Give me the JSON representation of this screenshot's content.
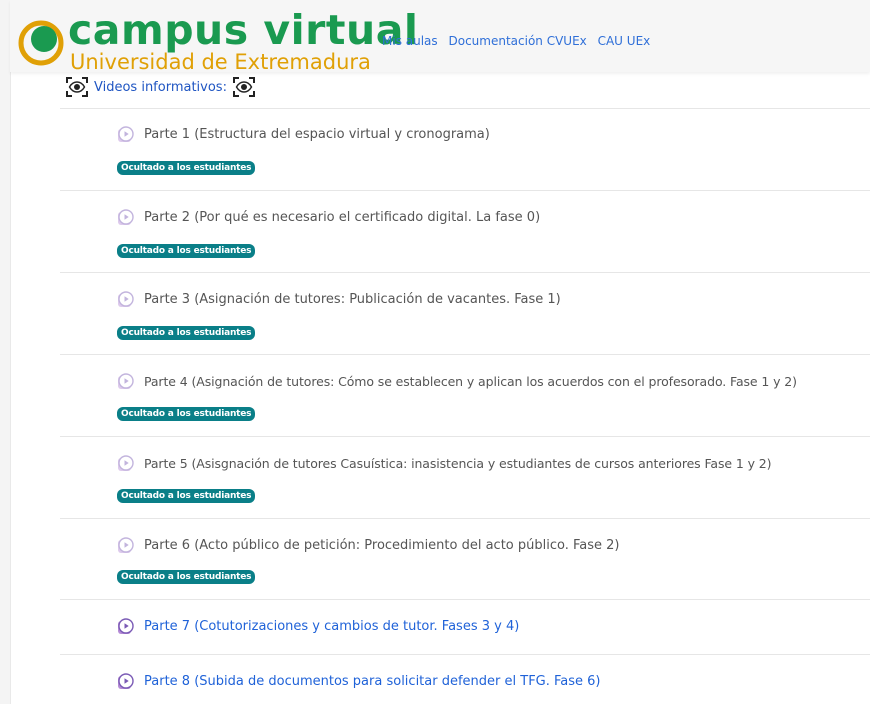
{
  "brand": {
    "title": "campus virtual",
    "subtitle": "Universidad de Extremadura",
    "colors": {
      "green": "#1a9a50",
      "gold": "#e0a006"
    }
  },
  "nav": {
    "links": [
      "Mis aulas",
      "Documentación CVUEx",
      "CAU UEx"
    ]
  },
  "section": {
    "title": "Videos informativos:",
    "icon": "eye-icon"
  },
  "items": [
    {
      "title": "Parte 1 (Estructura del espacio virtual y cronograma)",
      "badge": "Ocultado a los estudiantes"
    },
    {
      "title": "Parte 2 (Por qué es necesario el certificado digital. La fase 0)",
      "badge": "Ocultado a los estudiantes"
    },
    {
      "title": "Parte 3 (Asignación de tutores: Publicación de vacantes. Fase 1)",
      "badge": "Ocultado a los estudiantes"
    },
    {
      "title": "Parte 4 (Asignación de tutores: Cómo se establecen y aplican los acuerdos con el profesorado. Fase 1 y 2)",
      "badge": "Ocultado a los estudiantes"
    },
    {
      "title": "Parte 5 (Asisgnación de tutores Casuística: inasistencia y estudiantes de cursos anteriores Fase 1 y 2)",
      "badge": "Ocultado a los estudiantes"
    },
    {
      "title": "Parte 6 (Acto público de petición: Procedimiento del acto público. Fase 2)",
      "badge": "Ocultado a los estudiantes"
    },
    {
      "title": "Parte 7 (Cotutorizaciones y cambios de tutor. Fases 3 y 4)"
    },
    {
      "title": "Parte 8 (Subida de documentos para solicitar defender el TFG. Fase 6)"
    }
  ],
  "colors": {
    "badge": "#0a7f88",
    "link": "#1f62d8",
    "hidden_text": "#555555"
  }
}
